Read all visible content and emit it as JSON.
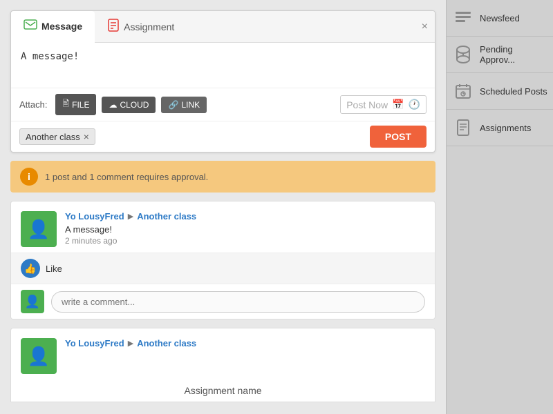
{
  "sidebar": {
    "items": [
      {
        "id": "newsfeed",
        "label": "Newsfeed",
        "icon": "newsfeed-icon"
      },
      {
        "id": "pending-approval",
        "label": "Pending Approv...",
        "icon": "pending-icon"
      },
      {
        "id": "scheduled-posts",
        "label": "Scheduled Posts",
        "icon": "scheduled-icon"
      },
      {
        "id": "assignments",
        "label": "Assignments",
        "icon": "assignments-icon"
      }
    ]
  },
  "compose": {
    "tab_message": "Message",
    "tab_assignment": "Assignment",
    "close_symbol": "×",
    "textarea_value": "A message!",
    "attach_label": "Attach:",
    "btn_file": "FILE",
    "btn_cloud": "CLOUD",
    "btn_link": "LINK",
    "post_date_placeholder": "Post Now",
    "calendar_icon": "📅",
    "clock_icon": "🕐",
    "recipient": "Another class",
    "remove_symbol": "×",
    "post_button": "POST"
  },
  "notification": {
    "icon": "i",
    "text": "1 post and 1 comment requires approval."
  },
  "posts": [
    {
      "author": "Yo LousyFred",
      "arrow": "▶",
      "class_name": "Another class",
      "body": "A message!",
      "time": "2 minutes ago",
      "like_label": "Like",
      "comment_placeholder": "write a comment..."
    },
    {
      "author": "Yo LousyFred",
      "arrow": "▶",
      "class_name": "Another class",
      "assignment_label": "Assignment name"
    }
  ],
  "icons": {
    "file_icon": "📄",
    "cloud_icon": "☁",
    "link_icon": "🔗",
    "like_icon": "👍",
    "newsfeed_symbol": "≡",
    "hourglass_symbol": "⏳",
    "calendar_symbol": "📅",
    "assignments_symbol": "📋"
  }
}
